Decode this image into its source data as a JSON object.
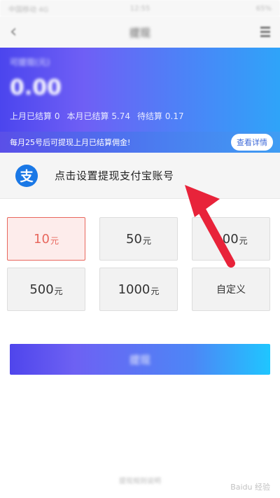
{
  "status_bar": {
    "carrier": "中国移动 4G",
    "time": "12:55",
    "battery": "65%"
  },
  "nav": {
    "title": "提现"
  },
  "balance": {
    "label": "可提现(元)",
    "amount": "0.00",
    "stats": [
      {
        "label": "上月已结算",
        "value": "0"
      },
      {
        "label": "本月已结算",
        "value": "5.74"
      },
      {
        "label": "待结算",
        "value": "0.17"
      }
    ]
  },
  "notice": {
    "text": "每月25号后可提现上月已结算佣金!",
    "detail_label": "查看详情"
  },
  "alipay": {
    "icon_char": "支",
    "text": "点击设置提现支付宝账号"
  },
  "amounts": [
    {
      "num": "10",
      "unit": "元",
      "selected": true
    },
    {
      "num": "50",
      "unit": "元"
    },
    {
      "num": "100",
      "unit": "元"
    },
    {
      "num": "500",
      "unit": "元"
    },
    {
      "num": "1000",
      "unit": "元"
    },
    {
      "label": "自定义"
    }
  ],
  "submit": {
    "label": "提现"
  },
  "footer": {
    "text": "提现规则说明"
  },
  "colors": {
    "accent": "#e8675d",
    "arrow": "#e8233a",
    "alipay": "#1a78e6"
  },
  "watermark": "Baidu 经验"
}
